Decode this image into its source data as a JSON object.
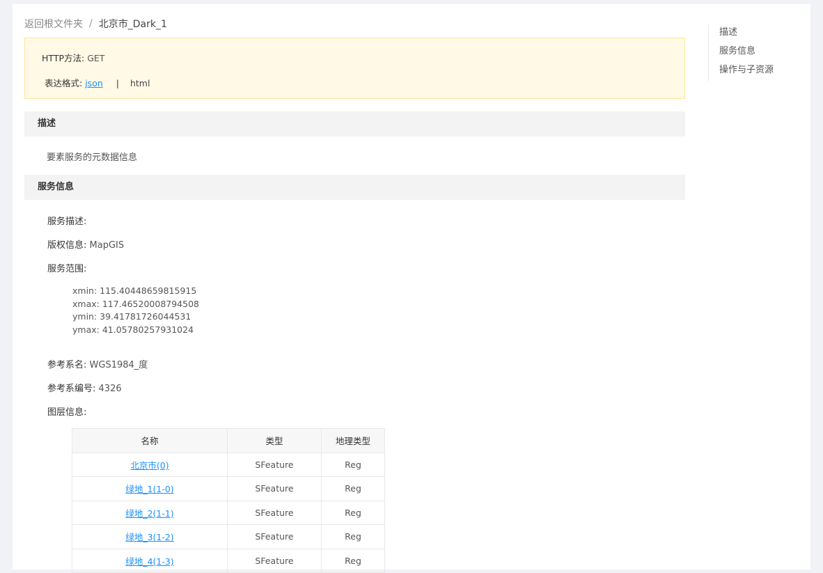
{
  "breadcrumb": {
    "back_label": "返回根文件夹",
    "separator": "/",
    "current": "北京市_Dark_1"
  },
  "http_info": {
    "method_label": "HTTP方法:",
    "method_value": "GET",
    "format_label": "表达格式:",
    "format_json": "json",
    "format_pipe": "|",
    "format_html": "html"
  },
  "description": {
    "header": "描述",
    "text": "要素服务的元数据信息"
  },
  "service_info": {
    "header": "服务信息",
    "service_desc_label": "服务描述:",
    "service_desc_value": "",
    "copyright_label": "版权信息:",
    "copyright_value": "MapGIS",
    "range_label": "服务范围:",
    "extent": {
      "xmin": "xmin: 115.40448659815915",
      "xmax": "xmax: 117.46520008794508",
      "ymin": "ymin: 39.41781726044531",
      "ymax": "ymax: 41.05780257931024"
    },
    "srs_name_label": "参考系名:",
    "srs_name_value": "WGS1984_度",
    "srs_code_label": "参考系编号:",
    "srs_code_value": "4326",
    "layer_info_label": "图层信息:"
  },
  "layers_table": {
    "headers": [
      "名称",
      "类型",
      "地理类型"
    ],
    "rows": [
      {
        "name": "北京市(0)",
        "type": "SFeature",
        "geom": "Reg"
      },
      {
        "name": "绿地_1(1-0)",
        "type": "SFeature",
        "geom": "Reg"
      },
      {
        "name": "绿地_2(1-1)",
        "type": "SFeature",
        "geom": "Reg"
      },
      {
        "name": "绿地_3(1-2)",
        "type": "SFeature",
        "geom": "Reg"
      },
      {
        "name": "绿地_4(1-3)",
        "type": "SFeature",
        "geom": "Reg"
      }
    ]
  },
  "toc": {
    "items": [
      "描述",
      "服务信息",
      "操作与子资源"
    ]
  },
  "colors": {
    "link": "#1890ff",
    "info_box_bg": "#fff9e6",
    "info_box_border": "#ffe59a",
    "section_header_bg": "#f3f3f3"
  }
}
